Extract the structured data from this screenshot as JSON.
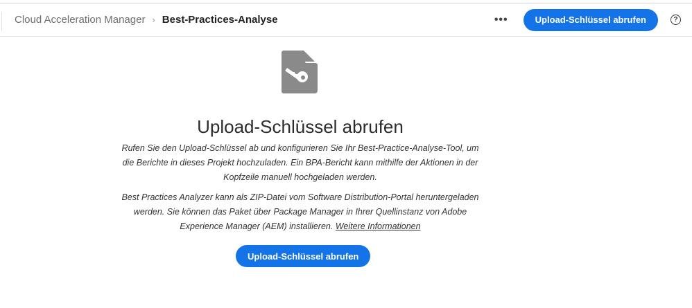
{
  "header": {
    "breadcrumb": [
      "Cloud Acceleration Manager",
      "Best-Practices-Analyse"
    ],
    "more_label": "•••",
    "primary_button": "Upload-Schlüssel abrufen",
    "help_label": "?"
  },
  "main": {
    "title": "Upload-Schlüssel abrufen",
    "paragraph1": "Rufen Sie den Upload-Schlüssel ab und konfigurieren Sie Ihr Best-Practice-Analyse-Tool, um die Berichte in dieses Projekt hochzuladen. Ein BPA-Bericht kann mithilfe der Aktionen in der Kopfzeile manuell hochgeladen werden.",
    "paragraph2": "Best Practices Analyzer kann als ZIP-Datei vom Software Distribution-Portal heruntergeladen werden. Sie können das Paket über Package Manager in Ihrer Quellinstanz von Adobe Experience Manager (AEM) installieren. ",
    "link": "Weitere Informationen",
    "button": "Upload-Schlüssel abrufen"
  }
}
